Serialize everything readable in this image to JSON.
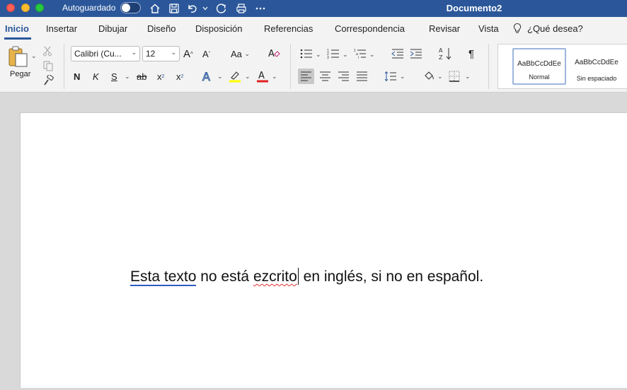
{
  "window": {
    "autosave_label": "Autoguardado",
    "autosave_on": false,
    "title": "Documento2"
  },
  "tabs": [
    {
      "label": "Inicio",
      "active": true
    },
    {
      "label": "Insertar"
    },
    {
      "label": "Dibujar"
    },
    {
      "label": "Diseño"
    },
    {
      "label": "Disposición"
    },
    {
      "label": "Referencias"
    },
    {
      "label": "Correspondencia"
    },
    {
      "label": "Revisar"
    },
    {
      "label": "Vista"
    }
  ],
  "tell_me": "¿Qué desea?",
  "ribbon": {
    "paste_label": "Pegar",
    "font_name": "Calibri (Cu...",
    "font_size": "12",
    "bold": "N",
    "italic": "K",
    "underline": "S",
    "strike": "ab",
    "subscript": "x",
    "superscript": "x",
    "case": "Aa",
    "grow": "A",
    "shrink": "A",
    "pilcrow": "¶",
    "highlight_color": "#ffff00",
    "font_color": "#e02020",
    "styles": [
      {
        "sample": "AaBbCcDdEe",
        "label": "Normal",
        "selected": true
      },
      {
        "sample": "AaBbCcDdEe",
        "label": "Sin espaciado"
      }
    ]
  },
  "document": {
    "word_grammar": "Esta texto",
    "text_mid": " no está ",
    "word_misspelled": "ezcrito",
    "text_end": " en inglés, si no en español."
  },
  "colors": {
    "brand": "#2b579a",
    "spell_underline": "#e03030",
    "grammar_underline": "#2f5bbf"
  }
}
